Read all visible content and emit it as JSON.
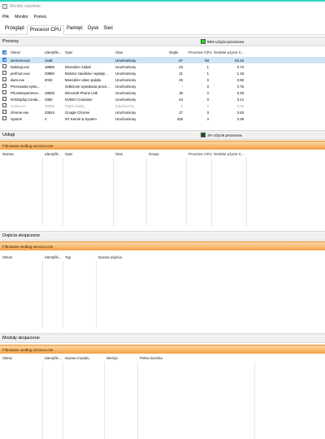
{
  "window": {
    "title": "Monitor zasobów"
  },
  "menu": [
    "Plik",
    "Monitor",
    "Pomoc"
  ],
  "tabs": [
    "Przegląd",
    "Procesor CPU",
    "Pamięć",
    "Dysk",
    "Sieć"
  ],
  "colors": {
    "accent": "#2fd5c9",
    "filter_orange": "#f5a142",
    "selected_row": "#cfe4f7",
    "cpu_green": "#1fdb1f",
    "services_green": "#0a5c1a"
  },
  "processes": {
    "header": "Procesy",
    "usage_label": "99% Użycie procesora",
    "columns": [
      "Obraz",
      "Identyfik...",
      "Opis",
      "Stan",
      "Wątki",
      "Procesor CPU",
      "Średnie użycie C..."
    ],
    "rows": [
      {
        "checked": true,
        "selected": true,
        "ended": false,
        "image": "services.exe",
        "pid": "1448",
        "desc": "",
        "state": "Uruchomiony",
        "threads": "57",
        "cpu": "93",
        "avg": "84.43"
      },
      {
        "checked": false,
        "selected": false,
        "ended": false,
        "image": "taskmgr.exe",
        "pid": "18868",
        "desc": "Menedżer zadań",
        "state": "Uruchomiony",
        "threads": "23",
        "cpu": "1",
        "avg": "0.73"
      },
      {
        "checked": false,
        "selected": false,
        "ended": false,
        "image": "perfmon.exe",
        "pid": "33960",
        "desc": "Monitor zasobów i wydajn...",
        "state": "Uruchomiony",
        "threads": "21",
        "cpu": "1",
        "avg": "1.18"
      },
      {
        "checked": false,
        "selected": false,
        "ended": false,
        "image": "dwm.exe",
        "pid": "2032",
        "desc": "Menedżer okien pulpitu",
        "state": "Uruchomiony",
        "threads": "45",
        "cpu": "0",
        "avg": "0.80"
      },
      {
        "checked": false,
        "selected": false,
        "ended": false,
        "image": "Przerwania syste...",
        "pid": "-",
        "desc": "Odłożone wywołania proce...",
        "state": "Uruchomiony",
        "threads": "-",
        "cpu": "0",
        "avg": "0.75"
      },
      {
        "checked": false,
        "selected": false,
        "ended": false,
        "image": "PhoneExperience...",
        "pid": "18928",
        "desc": "Microsoft Phone Link",
        "state": "Uruchomiony",
        "threads": "36",
        "cpu": "0",
        "avg": "0.28"
      },
      {
        "checked": false,
        "selected": false,
        "ended": false,
        "image": "NVDisplay.Contai...",
        "pid": "4360",
        "desc": "NVIDIA Container",
        "state": "Uruchomiony",
        "threads": "44",
        "cpu": "0",
        "avg": "0.14"
      },
      {
        "checked": false,
        "selected": false,
        "ended": true,
        "image": "mmdr.exe",
        "pid": "35000",
        "desc": "Pulpit zdalny",
        "state": "Zakończony",
        "threads": "5",
        "cpu": "0",
        "avg": "0.05"
      },
      {
        "checked": false,
        "selected": false,
        "ended": false,
        "image": "chrome.exe",
        "pid": "23524",
        "desc": "Google Chrome",
        "state": "Uruchomiony",
        "threads": "27",
        "cpu": "0",
        "avg": "0.53"
      },
      {
        "checked": false,
        "selected": false,
        "ended": false,
        "image": "System",
        "pid": "4",
        "desc": "NT Kernel & System",
        "state": "Uruchomiony",
        "threads": "425",
        "cpu": "0",
        "avg": "0.39"
      }
    ]
  },
  "services": {
    "header": "Usługi",
    "usage_label": "1% Użycie procesora",
    "filter": "Filtrowane według services.exe",
    "columns": [
      "Nazwa",
      "Identyfik...",
      "Opis",
      "Stan",
      "Grupa",
      "Procesor CPU",
      "Średnie użycie C..."
    ]
  },
  "handles": {
    "header": "Dojścia skojarzone",
    "filter": "Filtrowane według services.exe",
    "columns": [
      "Obraz",
      "Identyfik...",
      "Typ",
      "Nazwa dojścia"
    ]
  },
  "modules": {
    "header": "Moduły skojarzone",
    "filter": "Filtrowane według services.exe",
    "columns": [
      "Obraz",
      "Identyfik...",
      "Nazwa modułu",
      "Wersja",
      "Pełna ścieżka"
    ]
  }
}
